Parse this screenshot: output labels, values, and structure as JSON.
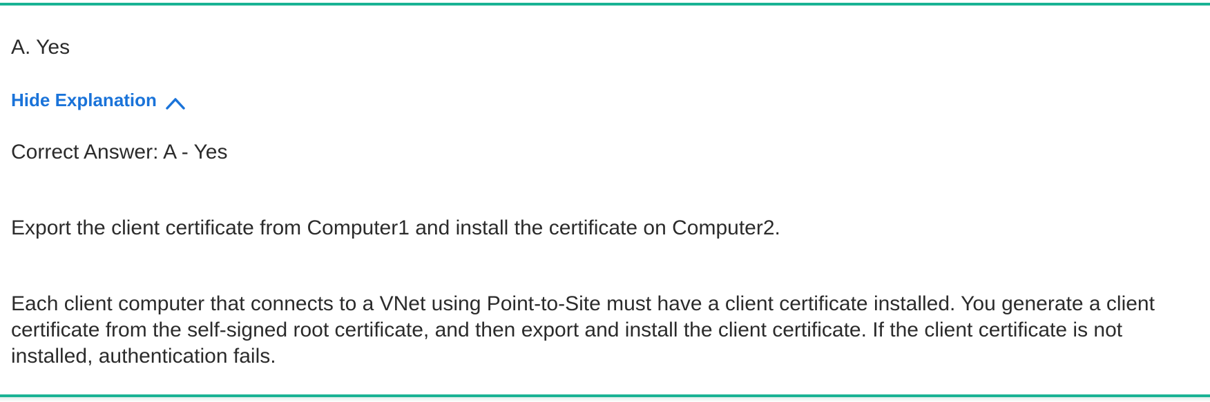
{
  "answer": {
    "option": "A. Yes"
  },
  "explanation": {
    "toggle_label": "Hide Explanation",
    "toggle_icon": "chevron-up-icon",
    "accent_color": "#1a73d9",
    "correct_answer": "Correct Answer: A - Yes",
    "paragraphs": [
      "Export the client certificate from Computer1 and install the certificate on Computer2.",
      "Each client computer that connects to a VNet using Point-to-Site must have a client certificate installed. You generate a client certificate from the self-signed root certificate, and then export and install the client certificate. If the client certificate is not installed, authentication fails."
    ]
  },
  "theme": {
    "border_color": "#1ab394"
  }
}
